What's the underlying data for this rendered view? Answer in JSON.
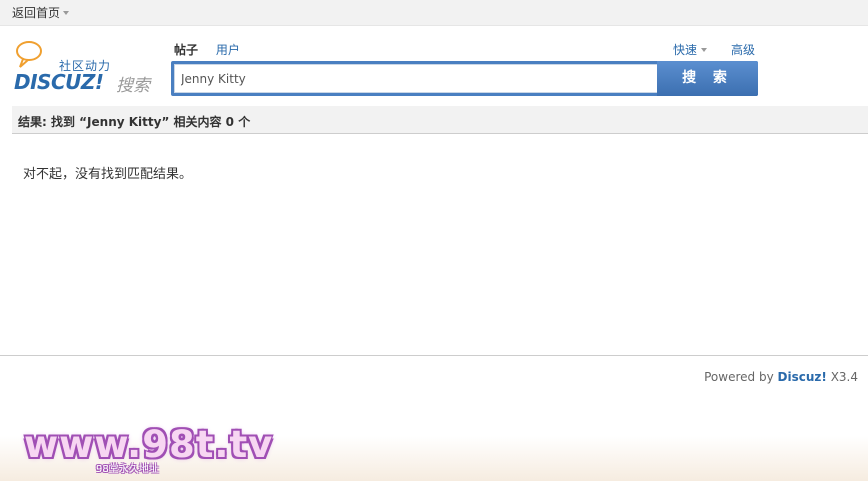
{
  "topbar": {
    "home_label": "返回首页"
  },
  "logo": {
    "slogan": "社区动力",
    "brand": "DISCUZ!",
    "brand_sub": "搜索"
  },
  "tabs": [
    {
      "label": "帖子",
      "active": true
    },
    {
      "label": "用户",
      "active": false
    }
  ],
  "links": {
    "quick": "快速",
    "advanced": "高级"
  },
  "search": {
    "value": "Jenny Kitty",
    "button_label": "搜 索"
  },
  "results": {
    "summary": "结果: 找到 “Jenny Kitty” 相关内容 0 个",
    "empty_message": "对不起，没有找到匹配结果。"
  },
  "footer": {
    "powered_prefix": "Powered by",
    "powered_brand": "Discuz!",
    "powered_version": "X3.4"
  },
  "watermark": {
    "main": "www.98t.tv",
    "sub": "98堂永久地址"
  },
  "colors": {
    "accent": "#4a7fc1",
    "link": "#2a6aab",
    "bar_bg": "#f2f2f2"
  }
}
